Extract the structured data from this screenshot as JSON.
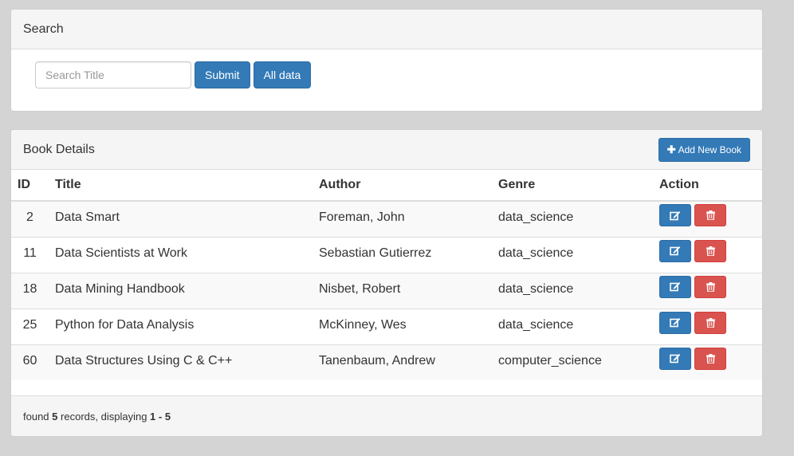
{
  "search_panel": {
    "title": "Search",
    "input_placeholder": "Search Title",
    "submit_label": "Submit",
    "all_data_label": "All data"
  },
  "book_panel": {
    "title": "Book Details",
    "add_button_label": "Add New Book",
    "add_button_icon": "plus-icon",
    "columns": [
      "ID",
      "Title",
      "Author",
      "Genre",
      "Action"
    ],
    "rows": [
      {
        "id": "2",
        "title": "Data Smart",
        "author": "Foreman, John",
        "genre": "data_science"
      },
      {
        "id": "11",
        "title": "Data Scientists at Work",
        "author": "Sebastian Gutierrez",
        "genre": "data_science"
      },
      {
        "id": "18",
        "title": "Data Mining Handbook",
        "author": "Nisbet, Robert",
        "genre": "data_science"
      },
      {
        "id": "25",
        "title": "Python for Data Analysis",
        "author": "McKinney, Wes",
        "genre": "data_science"
      },
      {
        "id": "60",
        "title": "Data Structures Using C & C++",
        "author": "Tanenbaum, Andrew",
        "genre": "computer_science"
      }
    ],
    "row_actions": {
      "edit_icon": "edit-icon",
      "delete_icon": "trash-icon"
    },
    "footer": {
      "prefix": "found",
      "count": "5",
      "middle": "records, displaying",
      "range": "1 - 5"
    }
  },
  "colors": {
    "primary": "#337ab7",
    "danger": "#d9534f",
    "page_background": "#d4d4d4"
  }
}
